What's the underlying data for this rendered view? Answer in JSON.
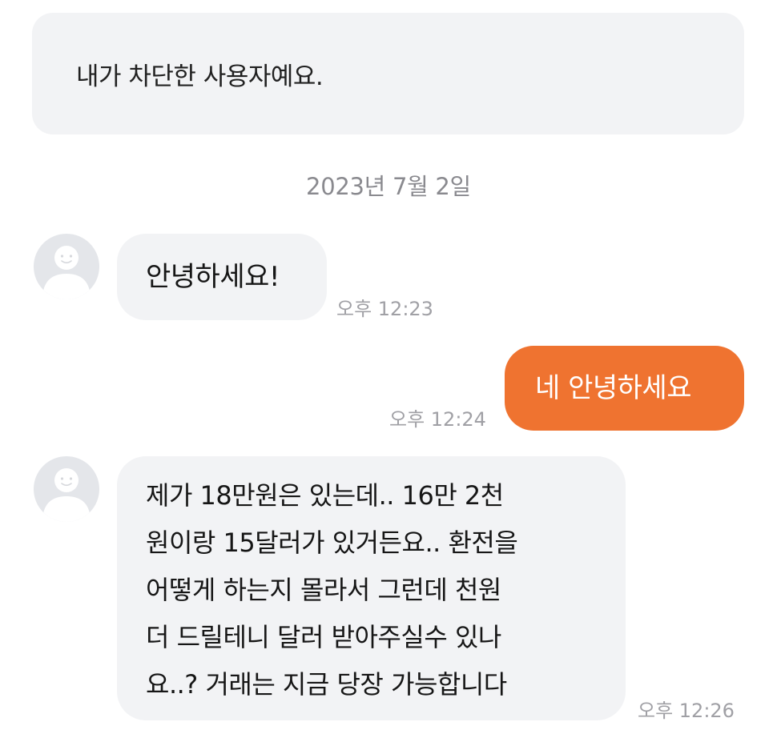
{
  "notice": {
    "text": "내가 차단한 사용자예요."
  },
  "date_separator": "2023년 7월 2일",
  "messages": [
    {
      "direction": "in",
      "text": "안녕하세요!",
      "time": "오후 12:23"
    },
    {
      "direction": "out",
      "text": "네 안녕하세요",
      "time": "오후 12:24"
    },
    {
      "direction": "in",
      "lines": [
        "제가 18만원은 있는데.. 16만 2천",
        "원이랑 15달러가 있거든요.. 환전을",
        "어떻게 하는지 몰라서 그런데 천원",
        "더 드릴테니 달러 받아주실수 있나",
        "요..? 거래는 지금 당장 가능합니다"
      ],
      "time": "오후 12:26"
    }
  ],
  "colors": {
    "outgoing_bubble": "#ef7330",
    "incoming_bubble": "#f2f3f5",
    "notice_background": "#f2f3f5",
    "timestamp": "#a0a0a5",
    "avatar_background": "#e4e6ea"
  },
  "icons": {
    "avatar": "default-user-avatar-icon"
  }
}
